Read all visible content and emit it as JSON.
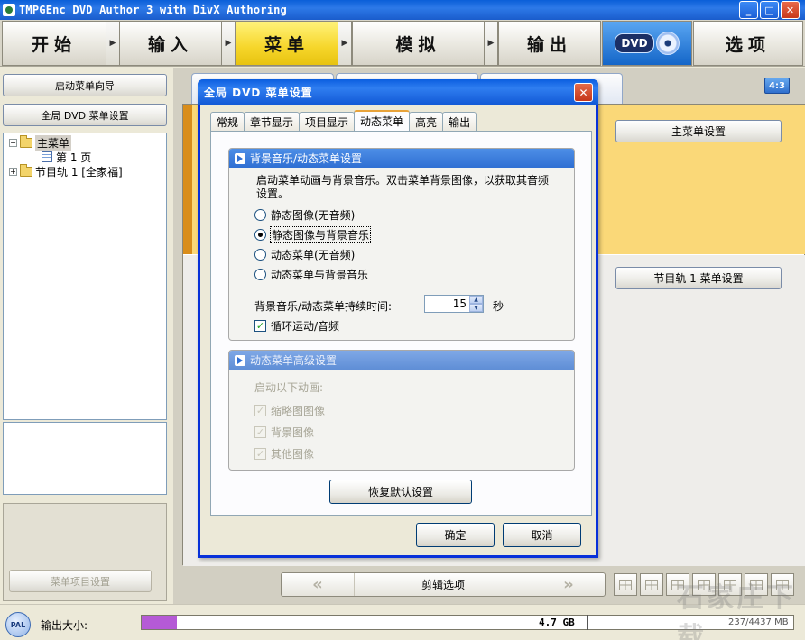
{
  "window": {
    "title": "TMPGEnc DVD Author 3 with DivX Authoring"
  },
  "steps": {
    "items": [
      "开始",
      "输入",
      "菜单",
      "模拟",
      "输出"
    ],
    "dvd_label": "DVD",
    "options_label": "选项"
  },
  "left": {
    "wizard_button": "启动菜单向导",
    "global_settings_button": "全局 DVD 菜单设置",
    "tree": {
      "root": "主菜单",
      "page": "第 1 页",
      "track": "节目轨 1 [全家福]"
    },
    "item_settings_button": "菜单项目设置"
  },
  "center": {
    "aspect_badge": "4:3",
    "main_menu_settings": "主菜单设置",
    "track_menu_settings": "节目轨 1 菜单设置",
    "edit_options": "剪辑选项",
    "nav_prev": "«",
    "nav_next": "»"
  },
  "status": {
    "tv_standard": "PAL",
    "output_size_label": "输出大小:",
    "capacity_label": "4.7 GB",
    "usage_text": "237/4437 MB",
    "used_mb": 237,
    "total_mb": 4437,
    "fill_color": "#b55ad6"
  },
  "dialog": {
    "title": "全局 DVD 菜单设置",
    "tabs": [
      "常规",
      "章节显示",
      "项目显示",
      "动态菜单",
      "高亮",
      "输出"
    ],
    "active_tab": "动态菜单",
    "bg_group": {
      "title": "背景音乐/动态菜单设置",
      "description": "启动菜单动画与背景音乐。双击菜单背景图像，以获取其音频设置。",
      "options": [
        "静态图像(无音频)",
        "静态图像与背景音乐",
        "动态菜单(无音频)",
        "动态菜单与背景音乐"
      ],
      "selected_index": 1,
      "duration_label": "背景音乐/动态菜单持续时间:",
      "duration_value": "15",
      "duration_unit": "秒",
      "loop_label": "循环运动/音频",
      "loop_checked": true
    },
    "adv_group": {
      "title": "动态菜单高级设置",
      "enable_label": "启动以下动画:",
      "checks": [
        "缩略图图像",
        "背景图像",
        "其他图像"
      ]
    },
    "restore_button": "恢复默认设置",
    "ok_button": "确定",
    "cancel_button": "取消"
  },
  "watermark": "石家庄下载"
}
